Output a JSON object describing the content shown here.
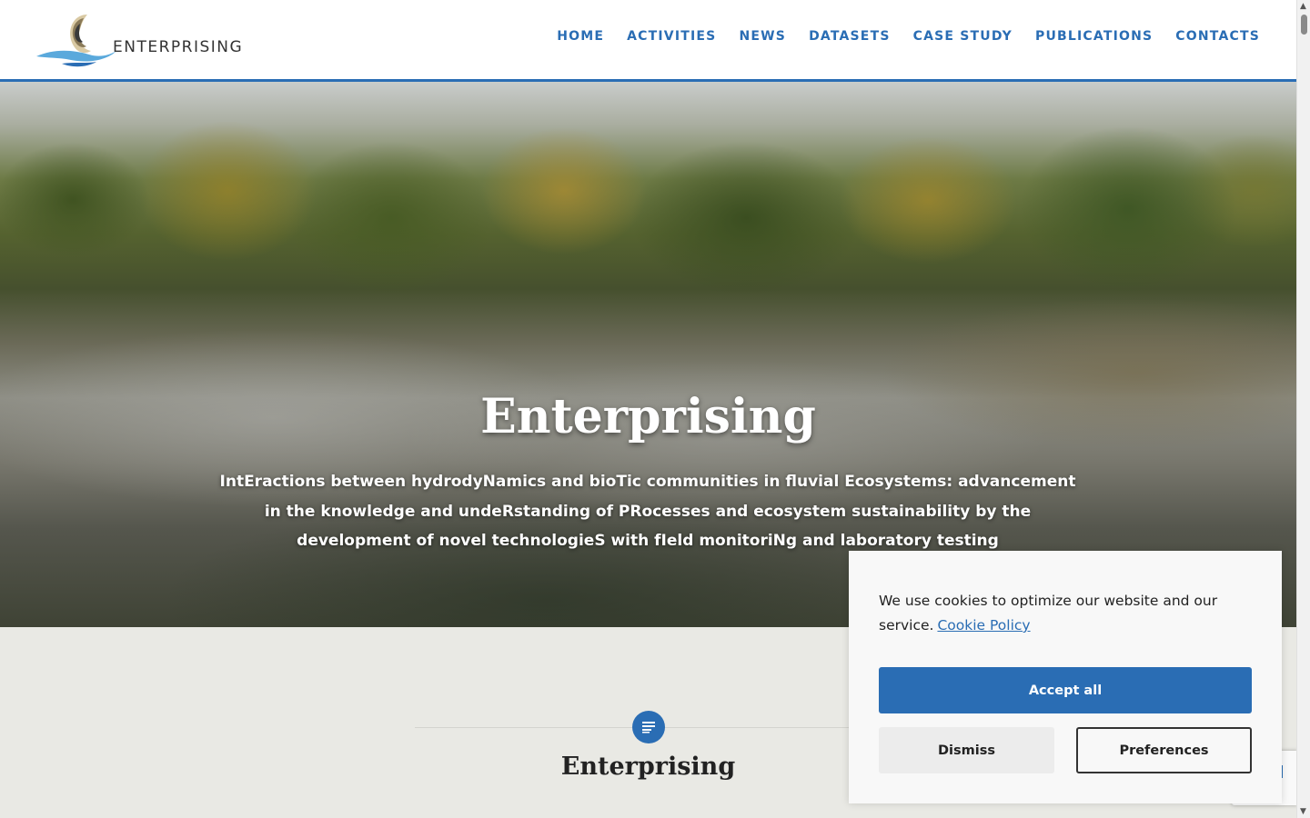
{
  "header": {
    "logo_text": "ENTERPRISING",
    "nav": [
      "HOME",
      "ACTIVITIES",
      "NEWS",
      "DATASETS",
      "CASE STUDY",
      "PUBLICATIONS",
      "CONTACTS"
    ]
  },
  "hero": {
    "title": "Enterprising",
    "subtitle": "IntEractions between hydrodyNamics and bioTic communities in fluvial Ecosystems: advancement in the knowledge and undeRstanding of PRocesses and ecosystem sustainability by the development of novel technologieS with fIeld monitoriNg and laboratory testing"
  },
  "section": {
    "icon": "document-icon",
    "title": "Enterprising"
  },
  "cookie": {
    "message": "We use cookies to optimize our website and our service.",
    "policy_link": "Cookie Policy",
    "accept_label": "Accept all",
    "dismiss_label": "Dismiss",
    "preferences_label": "Preferences"
  },
  "colors": {
    "accent": "#2a6db4",
    "section_bg": "#e9e9e4",
    "cookie_bg": "#f8f8f8"
  }
}
